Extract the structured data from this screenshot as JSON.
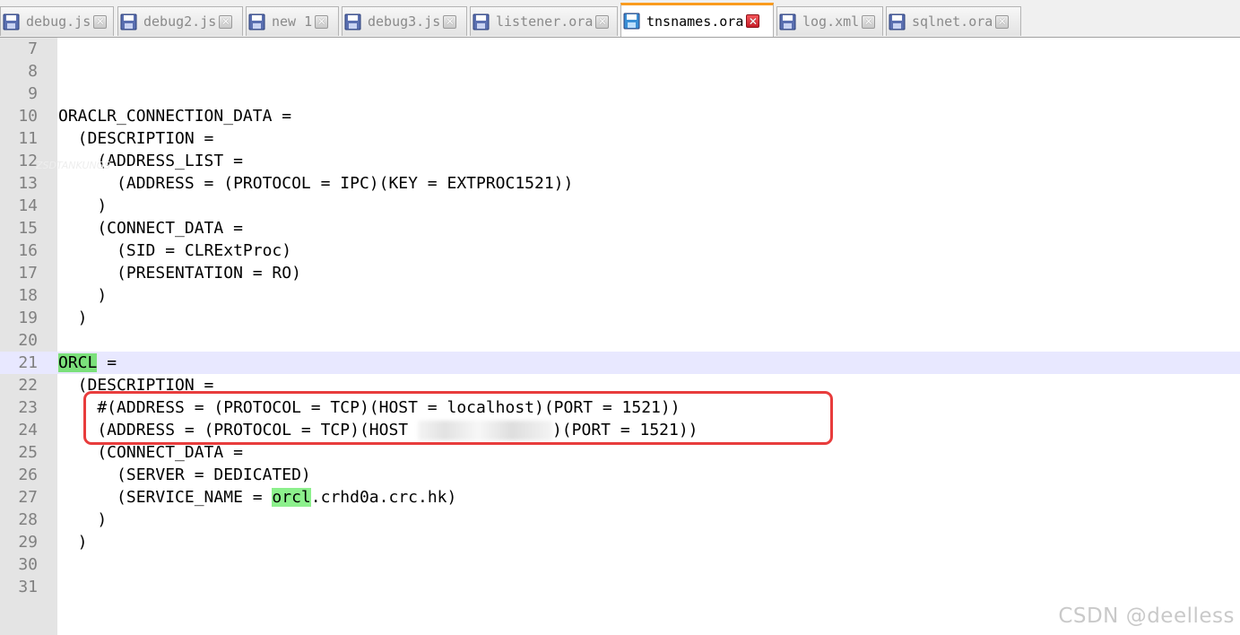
{
  "tabs": [
    {
      "label": "debug.js",
      "active": false
    },
    {
      "label": "debug2.js",
      "active": false
    },
    {
      "label": "new 1",
      "active": false
    },
    {
      "label": "debug3.js",
      "active": false
    },
    {
      "label": "listener.ora",
      "active": false
    },
    {
      "label": "tnsnames.ora",
      "active": true
    },
    {
      "label": "log.xml",
      "active": false
    },
    {
      "label": "sqlnet.ora",
      "active": false
    }
  ],
  "editor": {
    "current_line": 21,
    "lines": [
      {
        "n": "7",
        "text": ""
      },
      {
        "n": "8",
        "text": ""
      },
      {
        "n": "9",
        "text": ""
      },
      {
        "n": "10",
        "text": "ORACLR_CONNECTION_DATA ="
      },
      {
        "n": "11",
        "text": "  (DESCRIPTION ="
      },
      {
        "n": "12",
        "text": "    (ADDRESS_LIST ="
      },
      {
        "n": "13",
        "text": "      (ADDRESS = (PROTOCOL = IPC)(KEY = EXTPROC1521))"
      },
      {
        "n": "14",
        "text": "    )"
      },
      {
        "n": "15",
        "text": "    (CONNECT_DATA ="
      },
      {
        "n": "16",
        "text": "      (SID = CLRExtProc)"
      },
      {
        "n": "17",
        "text": "      (PRESENTATION = RO)"
      },
      {
        "n": "18",
        "text": "    )"
      },
      {
        "n": "19",
        "text": "  )"
      },
      {
        "n": "20",
        "text": ""
      },
      {
        "n": "21",
        "pre": "",
        "hl": "ORCL",
        "post": " ="
      },
      {
        "n": "22",
        "text": "  (DESCRIPTION ="
      },
      {
        "n": "23",
        "text": "    #(ADDRESS = (PROTOCOL = TCP)(HOST = localhost)(PORT = 1521))"
      },
      {
        "n": "24",
        "pre": "    (ADDRESS = (PROTOCOL = TCP)(HOST ",
        "post": ")(PORT = 1521))"
      },
      {
        "n": "25",
        "text": "    (CONNECT_DATA ="
      },
      {
        "n": "26",
        "text": "      (SERVER = DEDICATED)"
      },
      {
        "n": "27",
        "pre": "      (SERVICE_NAME = ",
        "hl": "orcl",
        "post": ".crhd0a.crc.hk)"
      },
      {
        "n": "28",
        "text": "    )"
      },
      {
        "n": "29",
        "text": "  )"
      },
      {
        "n": "30",
        "text": ""
      },
      {
        "n": "31",
        "text": ""
      }
    ]
  },
  "watermark": "CSDN @deelless",
  "colors": {
    "active_tab_accent": "#fa9b1e",
    "current_line_bg": "#e8e8ff",
    "match_highlight": "#7be07b",
    "annotation_box": "#e83c3c"
  }
}
